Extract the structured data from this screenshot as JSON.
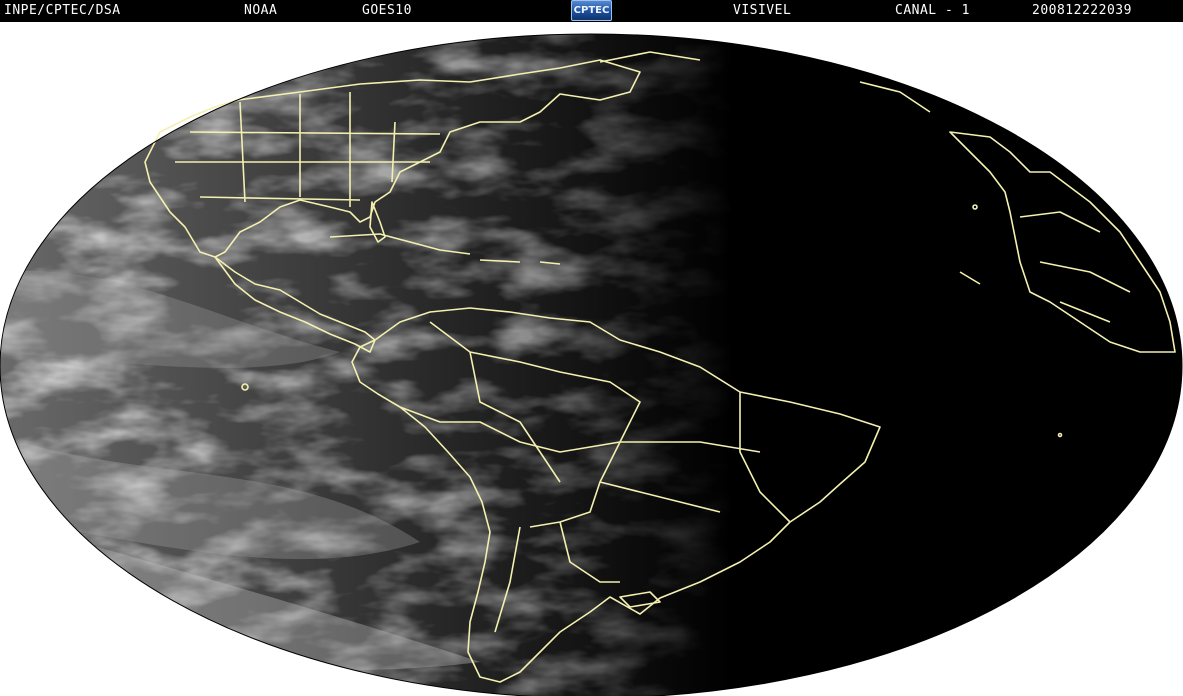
{
  "header": {
    "institution": "INPE/CPTEC/DSA",
    "agency": "NOAA",
    "satellite": "GOES10",
    "logo_text": "CPTEC",
    "band": "VISIVEL",
    "channel": "CANAL - 1",
    "timestamp": "200812222039"
  },
  "colors": {
    "background": "#ffffff",
    "header_bg": "#000000",
    "header_text": "#ffffff",
    "border_lines": "#f4f0b0",
    "space": "#000000"
  }
}
